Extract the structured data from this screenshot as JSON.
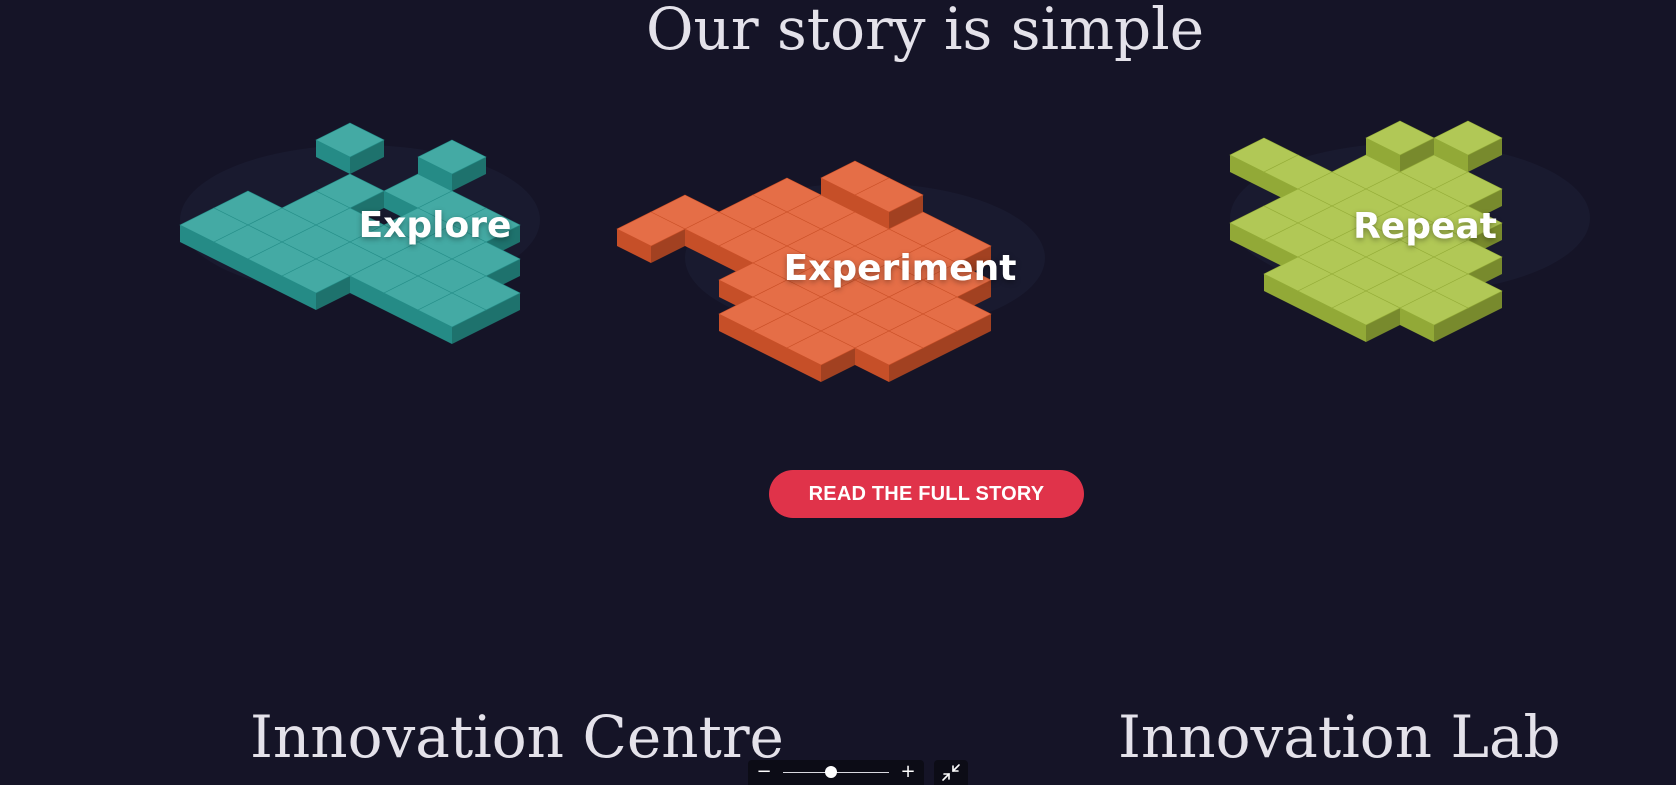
{
  "story": {
    "title": "Our story is simple",
    "tiles": [
      {
        "label": "Explore",
        "color": "#2a9e98"
      },
      {
        "label": "Experiment",
        "color": "#e15a2e"
      },
      {
        "label": "Repeat",
        "color": "#a6c03f"
      }
    ],
    "cta_label": "READ THE FULL STORY",
    "cta_color": "#e0334a"
  },
  "sections": {
    "left_title": "Innovation Centre",
    "right_title": "Innovation Lab"
  },
  "zoom_control": {
    "minus_icon": "minus-icon",
    "plus_icon": "plus-icon",
    "level": 0.45,
    "collapse_icon": "collapse-arrows-icon"
  }
}
